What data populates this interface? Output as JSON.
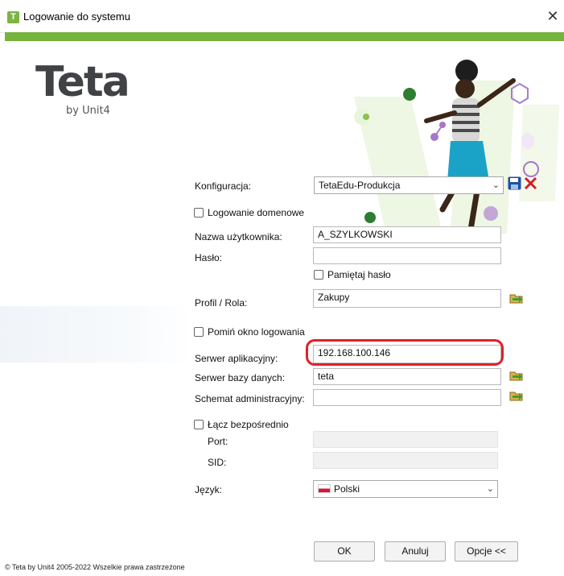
{
  "window": {
    "title": "Logowanie do systemu",
    "app_icon_letter": "T",
    "close_glyph": "✕"
  },
  "brand": {
    "logo": "Teta",
    "sub": "by Unit4"
  },
  "form": {
    "configuration": {
      "label": "Konfiguracja:",
      "value": "TetaEdu-Produkcja"
    },
    "domain_login": {
      "label": "Logowanie domenowe",
      "checked": false
    },
    "username": {
      "label": "Nazwa użytkownika:",
      "value": "A_SZYLKOWSKI"
    },
    "password": {
      "label": "Hasło:",
      "value": ""
    },
    "remember_password": {
      "label": "Pamiętaj hasło",
      "checked": false
    },
    "profile": {
      "label": "Profil / Rola:",
      "value": "Zakupy"
    },
    "skip_login_window": {
      "label": "Pomiń okno logowania",
      "checked": false
    },
    "app_server": {
      "label": "Serwer aplikacyjny:",
      "value": "192.168.100.146"
    },
    "db_server": {
      "label": "Serwer bazy danych:",
      "value": "teta"
    },
    "admin_schema": {
      "label": "Schemat administracyjny:",
      "value": ""
    },
    "direct_connect": {
      "label": "Łącz bezpośrednio",
      "checked": false
    },
    "port": {
      "label": "Port:",
      "value": ""
    },
    "sid": {
      "label": "SID:",
      "value": ""
    },
    "language": {
      "label": "Język:",
      "value": "Polski"
    }
  },
  "buttons": {
    "ok": "OK",
    "cancel": "Anuluj",
    "options": "Opcje <<"
  },
  "footer": {
    "copyright": "© Teta by Unit4 2005-2022 Wszelkie prawa zastrzeżone"
  },
  "colors": {
    "accent": "#75b43d",
    "highlight": "#e0202a",
    "save_icon": "#1f4f9e",
    "delete_icon": "#d0202a"
  },
  "icons": [
    "app-icon",
    "close-icon",
    "save-icon",
    "delete-icon",
    "folder-lookup-icon",
    "chevron-down-icon",
    "poland-flag-icon"
  ]
}
